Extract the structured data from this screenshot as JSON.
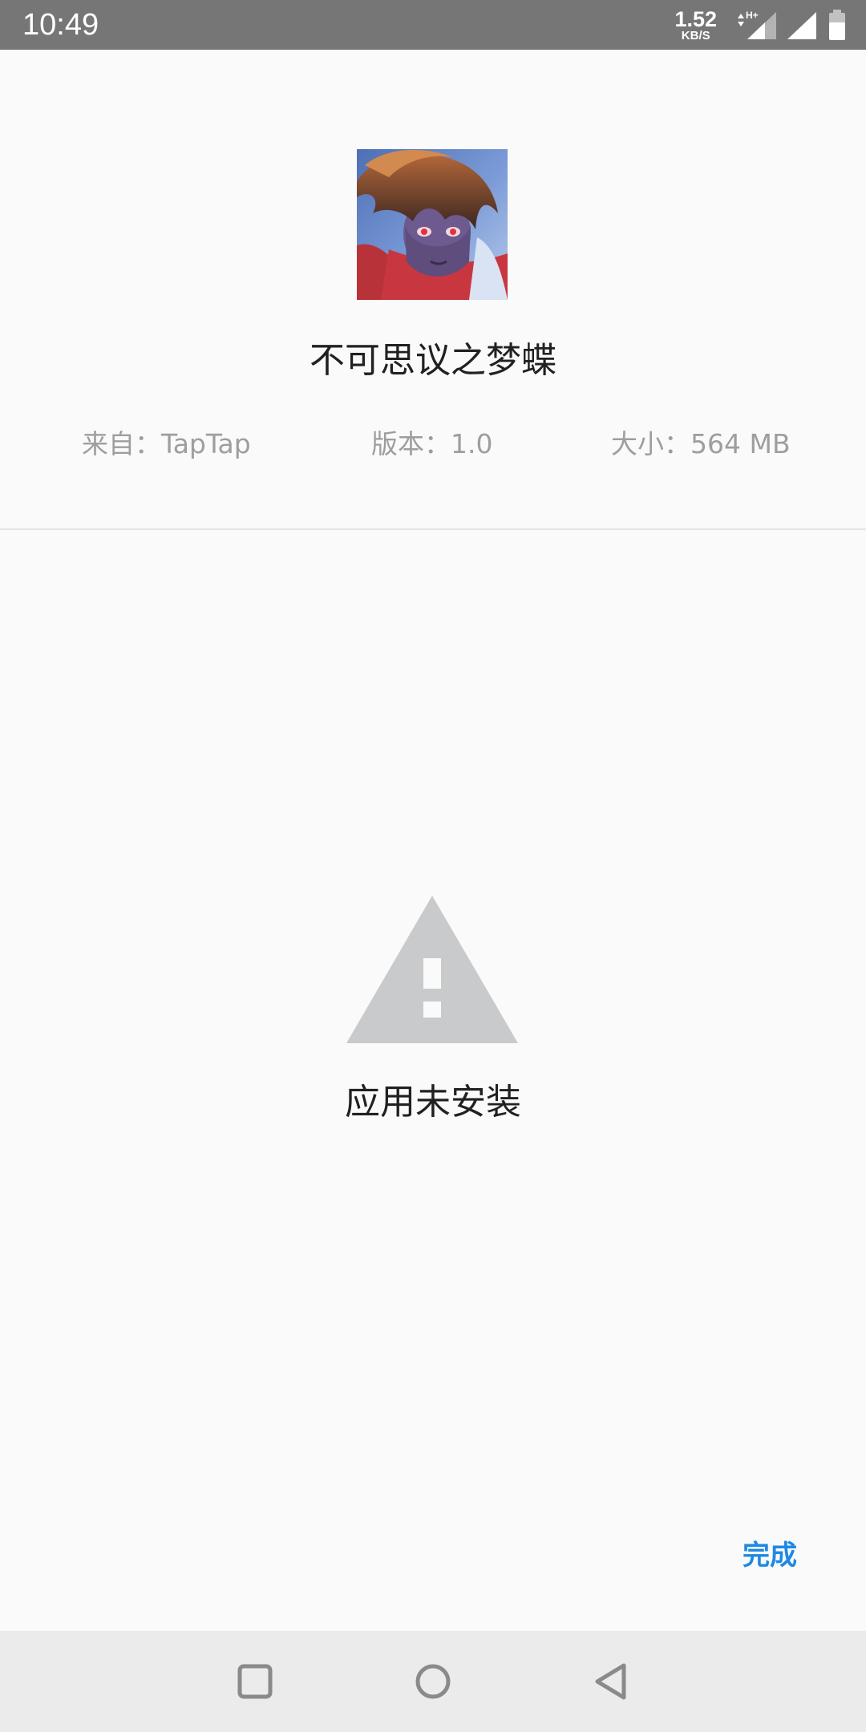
{
  "status_bar": {
    "time": "10:49",
    "net_speed_value": "1.52",
    "net_speed_unit": "KB/S",
    "network_type": "H+",
    "icons": [
      "data-arrows-icon",
      "signal-icon",
      "signal-icon",
      "battery-icon"
    ]
  },
  "app": {
    "icon": "app-icon",
    "name": "不可思议之梦蝶",
    "source_label": "来自：TapTap",
    "version_label": "版本：1.0",
    "size_label": "大小：564 MB"
  },
  "result": {
    "icon": "warning-icon",
    "message": "应用未安装"
  },
  "actions": {
    "done_label": "完成"
  },
  "nav_bar": {
    "icons": [
      "recents-icon",
      "home-icon",
      "back-icon"
    ]
  },
  "colors": {
    "status_bar_bg": "#767676",
    "background": "#fafafa",
    "accent": "#1e88e5",
    "warning_icon": "#c8cacc",
    "nav_bar_bg": "#ebebeb"
  }
}
